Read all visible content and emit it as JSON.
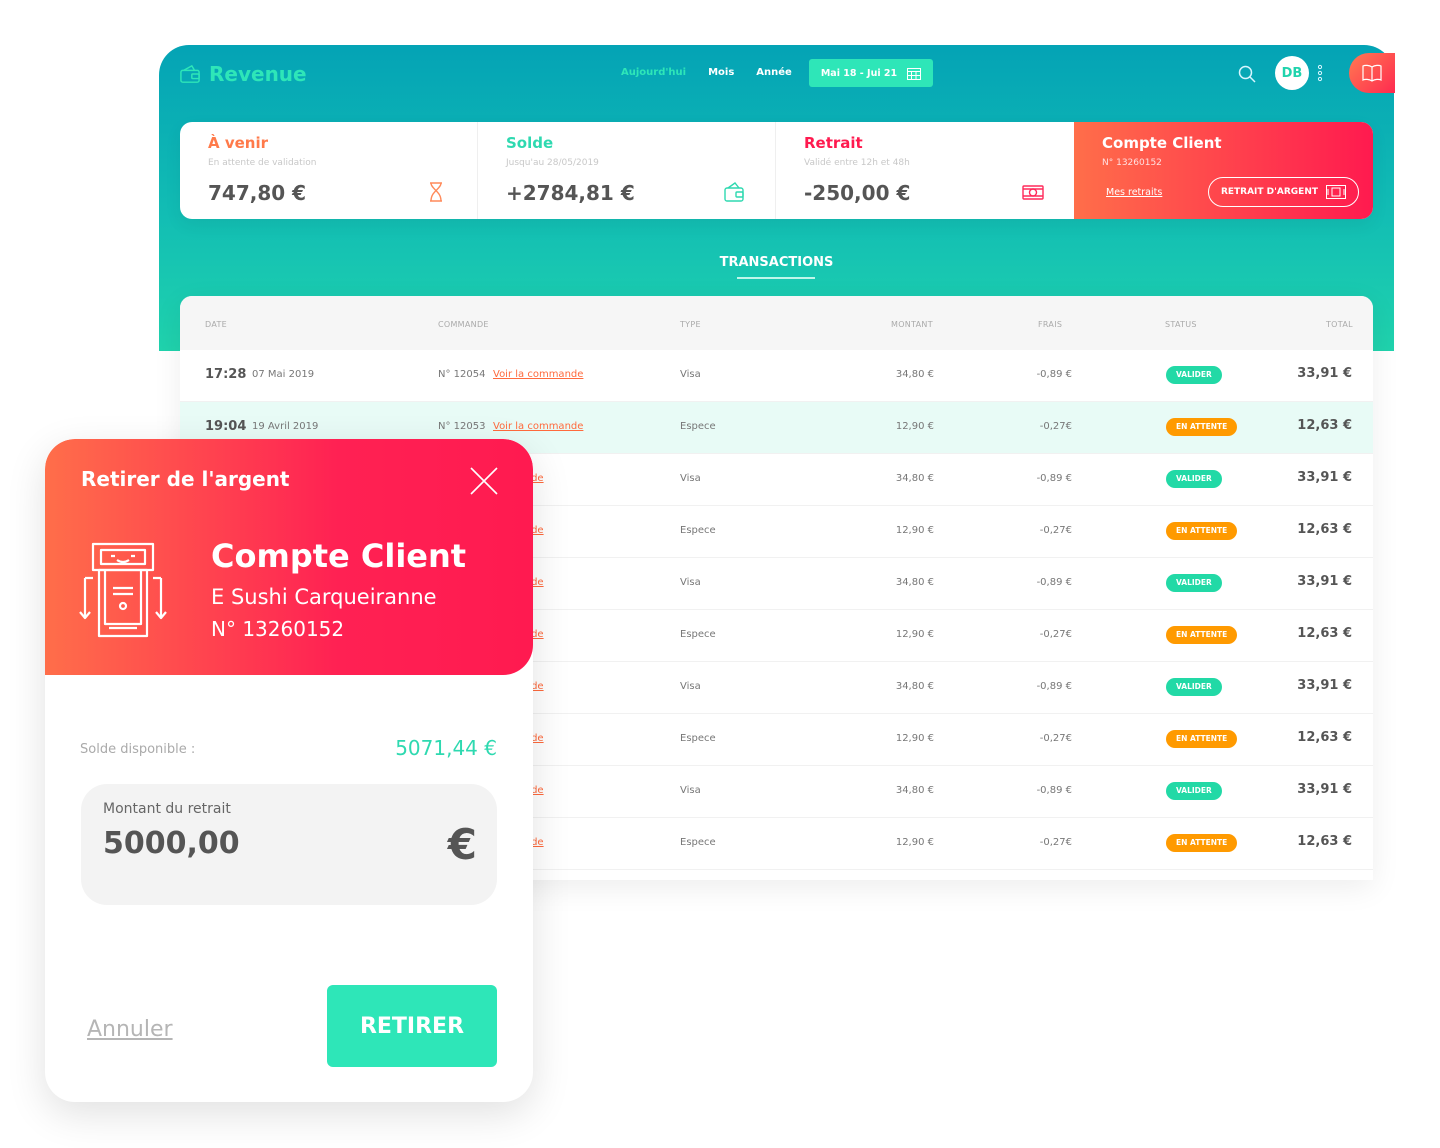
{
  "app": {
    "title": "Revenue"
  },
  "period_nav": [
    {
      "label": "Aujourd'hui",
      "active": true
    },
    {
      "label": "Mois",
      "active": false
    },
    {
      "label": "Année",
      "active": false
    }
  ],
  "date_range": "Mai 18 - Jui 21",
  "user": {
    "initials": "DB"
  },
  "colors": {
    "teal": "#04a3b5",
    "mint": "#2ee6b8",
    "coral": "#ff6e4a",
    "red": "#ff1a4f",
    "orange_status": "#ff9a00",
    "green_status": "#22d9a6"
  },
  "cards": [
    {
      "title": "À venir",
      "subtitle": "En attente de validation",
      "value": "747,80 €",
      "color": "#ff7a4a",
      "icon": "hourglass-icon"
    },
    {
      "title": "Solde",
      "subtitle": "Jusqu'au 28/05/2019",
      "value": "+2784,81 €",
      "color": "#2ed9b0",
      "icon": "wallet-icon"
    },
    {
      "title": "Retrait",
      "subtitle": "Validé entre 12h et 48h",
      "value": "-250,00 €",
      "color": "#ff1a4f",
      "icon": "cash-icon"
    }
  ],
  "client_card": {
    "title": "Compte Client",
    "number": "N° 13260152",
    "link": "Mes retraits",
    "button": "RETRAIT D'ARGENT"
  },
  "transactions": {
    "title": "TRANSACTIONS",
    "headers": {
      "date": "DATE",
      "order": "COMMANDE",
      "type": "TYPE",
      "amount": "MONTANT",
      "fees": "FRAIS",
      "status": "STATUS",
      "total": "TOTAL"
    },
    "rows": [
      {
        "time": "17:28",
        "date": "07 Mai 2019",
        "order": "N° 12054",
        "link": "Voir la commande",
        "type": "Visa",
        "amount": "34,80 €",
        "fees": "-0,89 €",
        "status": "VALIDER",
        "total": "33,91 €"
      },
      {
        "time": "19:04",
        "date": "19 Avril 2019",
        "order": "N° 12053",
        "link": "Voir la commande",
        "type": "Espece",
        "amount": "12,90 €",
        "fees": "-0,27€",
        "status": "EN ATTENTE",
        "total": "12,63 €"
      },
      {
        "time": "",
        "date": "",
        "order": "",
        "link": "ommande",
        "type": "Visa",
        "amount": "34,80 €",
        "fees": "-0,89 €",
        "status": "VALIDER",
        "total": "33,91 €"
      },
      {
        "time": "",
        "date": "",
        "order": "",
        "link": "ommande",
        "type": "Espece",
        "amount": "12,90 €",
        "fees": "-0,27€",
        "status": "EN ATTENTE",
        "total": "12,63 €"
      },
      {
        "time": "",
        "date": "",
        "order": "",
        "link": "ommande",
        "type": "Visa",
        "amount": "34,80 €",
        "fees": "-0,89 €",
        "status": "VALIDER",
        "total": "33,91 €"
      },
      {
        "time": "",
        "date": "",
        "order": "",
        "link": "ommande",
        "type": "Espece",
        "amount": "12,90 €",
        "fees": "-0,27€",
        "status": "EN ATTENTE",
        "total": "12,63 €"
      },
      {
        "time": "",
        "date": "",
        "order": "",
        "link": "ommande",
        "type": "Visa",
        "amount": "34,80 €",
        "fees": "-0,89 €",
        "status": "VALIDER",
        "total": "33,91 €"
      },
      {
        "time": "",
        "date": "",
        "order": "",
        "link": "ommande",
        "type": "Espece",
        "amount": "12,90 €",
        "fees": "-0,27€",
        "status": "EN ATTENTE",
        "total": "12,63 €"
      },
      {
        "time": "",
        "date": "",
        "order": "",
        "link": "ommande",
        "type": "Visa",
        "amount": "34,80 €",
        "fees": "-0,89 €",
        "status": "VALIDER",
        "total": "33,91 €"
      },
      {
        "time": "",
        "date": "",
        "order": "",
        "link": "ommande",
        "type": "Espece",
        "amount": "12,90 €",
        "fees": "-0,27€",
        "status": "EN ATTENTE",
        "total": "12,63 €"
      }
    ]
  },
  "modal": {
    "title": "Retirer de l'argent",
    "account_name": "Compte Client",
    "account_place": "E Sushi Carqueiranne",
    "account_number": "N° 13260152",
    "balance_label": "Solde disponible :",
    "balance_value": "5071,44 €",
    "amount_label": "Montant du retrait",
    "amount_value": "5000,00",
    "currency": "€",
    "cancel": "Annuler",
    "submit": "RETIRER"
  }
}
